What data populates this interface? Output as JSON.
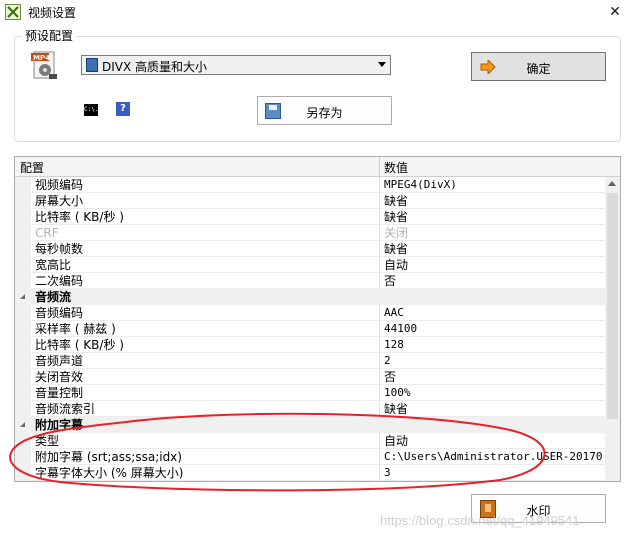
{
  "window": {
    "title": "视频设置",
    "close_glyph": "✕"
  },
  "preset": {
    "group_label": "预设配置",
    "selected": "DIVX 高质量和大小",
    "ok_label": "确定",
    "saveas_label": "另存为",
    "cmd_icon_text": "C:\\."
  },
  "grid": {
    "col_name": "配置",
    "col_value": "数值",
    "rows": [
      {
        "name": "视频编码",
        "value": "MPEG4(DivX)"
      },
      {
        "name": "屏幕大小",
        "value": "缺省"
      },
      {
        "name": "比特率 ( KB/秒 )",
        "value": "缺省"
      },
      {
        "name": "CRF",
        "value": "关闭"
      },
      {
        "name": "每秒帧数",
        "value": "缺省"
      },
      {
        "name": "宽高比",
        "value": "自动"
      },
      {
        "name": "二次编码",
        "value": "否"
      },
      {
        "name": "音频流",
        "value": ""
      },
      {
        "name": "音频编码",
        "value": "AAC"
      },
      {
        "name": "采样率 ( 赫兹 )",
        "value": "44100"
      },
      {
        "name": "比特率 ( KB/秒 )",
        "value": "128"
      },
      {
        "name": "音频声道",
        "value": "2"
      },
      {
        "name": "关闭音效",
        "value": "否"
      },
      {
        "name": "音量控制",
        "value": "100%"
      },
      {
        "name": "音频流索引",
        "value": "缺省"
      },
      {
        "name": "附加字幕",
        "value": ""
      },
      {
        "name": "类型",
        "value": "自动"
      },
      {
        "name": "附加字幕 (srt;ass;ssa;idx)",
        "value": "C:\\Users\\Administrator.USER-20170..."
      },
      {
        "name": "字幕字体大小 (% 屏幕大小)",
        "value": "3"
      }
    ]
  },
  "watermark_label": "水印",
  "csdn_watermark": "https://blog.csdn.net/qq_41949541",
  "colors": {
    "annotation": "#e8202a",
    "accent": "#3b5cc6"
  }
}
